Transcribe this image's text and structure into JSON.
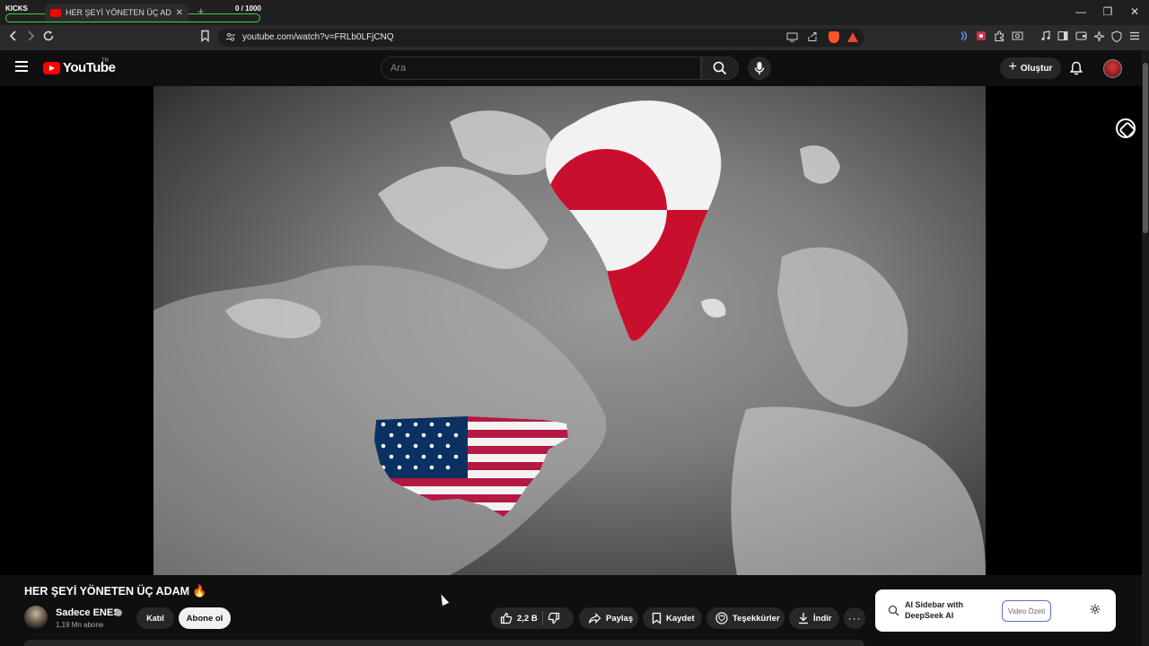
{
  "browser": {
    "kicks_label": "KICKS",
    "kicks_counter": "0  / 1000",
    "tab_title": "HER ŞEYİ YÖNETEN ÜÇ ADAM",
    "tab_close": "✕",
    "new_tab": "+",
    "url": "youtube.com/watch?v=FRLb0LFjCNQ",
    "window": {
      "minimize": "—",
      "restore": "❐",
      "close": "✕"
    }
  },
  "header": {
    "logo_text": "YouTube",
    "country_code": "TR",
    "search_placeholder": "Ara",
    "create_label": "Oluştur"
  },
  "video": {
    "title": "HER ŞEYİ YÖNETEN ÜÇ ADAM",
    "title_emoji": "🔥"
  },
  "channel": {
    "name": "Sadece ENES",
    "subscribers": "1,19 Mn abone",
    "join_label": "Katıl",
    "subscribe_label": "Abone ol"
  },
  "actions": {
    "likes": "2,2 B",
    "share": "Paylaş",
    "save": "Kaydet",
    "thanks": "Teşekkürler",
    "download": "İndir",
    "more": "···"
  },
  "ai_sidebar": {
    "title": "AI Sidebar with DeepSeek AI",
    "summary_button": "Video Özeti"
  },
  "colors": {
    "yt_red": "#ff0000",
    "greenland_red": "#c8102e",
    "usa_blue": "#0a3161",
    "usa_red": "#b31942",
    "kicks_green": "#3bd63b"
  }
}
